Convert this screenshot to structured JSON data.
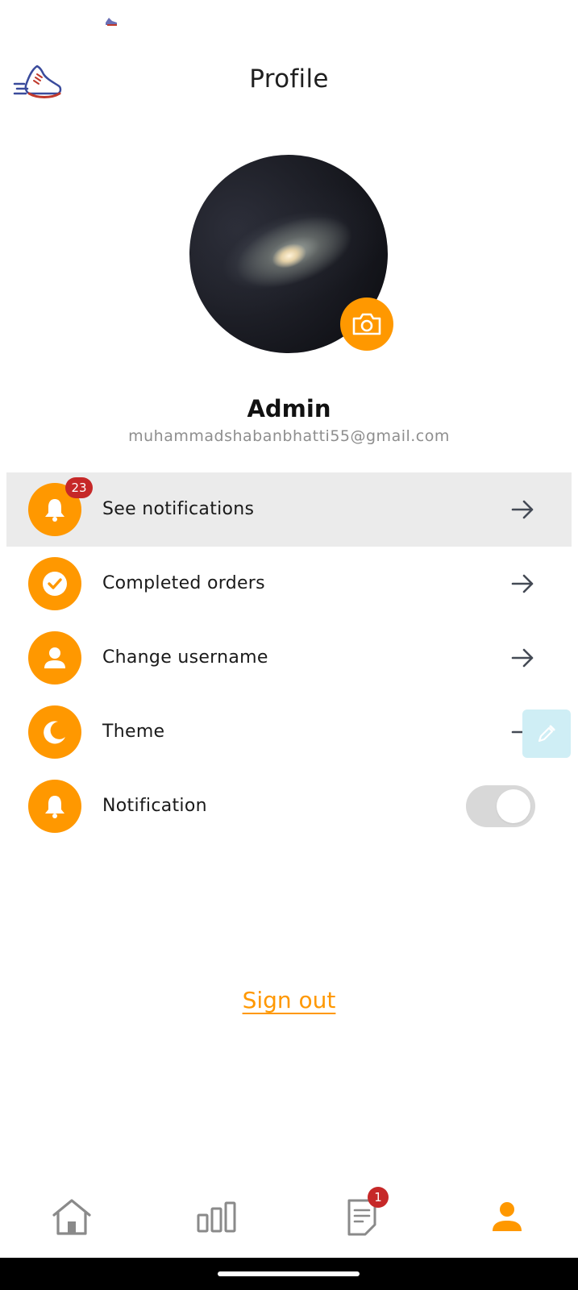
{
  "header": {
    "title": "Profile",
    "logo_icon": "running-shoe-icon"
  },
  "profile": {
    "name": "Admin",
    "email": "muhammadshabanbhatti55@gmail.com",
    "camera_icon": "camera-icon"
  },
  "menu": {
    "items": [
      {
        "label": "See notifications",
        "icon": "bell-icon",
        "badge": "23",
        "trailing": "arrow-right-icon"
      },
      {
        "label": "Completed orders",
        "icon": "check-circle-icon",
        "trailing": "arrow-right-icon"
      },
      {
        "label": "Change username",
        "icon": "person-icon",
        "trailing": "arrow-right-icon"
      },
      {
        "label": "Theme",
        "icon": "moon-icon",
        "trailing": "arrow-right-icon"
      },
      {
        "label": "Notification",
        "icon": "bell-icon",
        "trailing": "toggle",
        "toggle_on": false
      }
    ]
  },
  "sign_out_label": "Sign out",
  "bottom_nav": {
    "items": [
      {
        "icon": "home-icon",
        "active": false
      },
      {
        "icon": "bar-chart-icon",
        "active": false
      },
      {
        "icon": "orders-icon",
        "active": false,
        "badge": "1"
      },
      {
        "icon": "profile-icon",
        "active": true
      }
    ]
  },
  "colors": {
    "accent": "#ff9800",
    "badge": "#c62828",
    "inactive_nav": "#8a8a8a",
    "highlight_row": "#ebebeb",
    "text_secondary": "#8e8e8e"
  }
}
